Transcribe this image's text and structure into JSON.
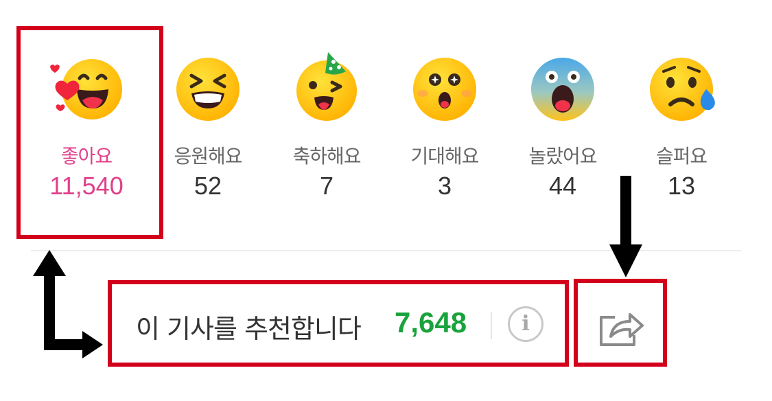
{
  "reactions": [
    {
      "name": "like",
      "label": "좋아요",
      "count": "11,540",
      "selected": true
    },
    {
      "name": "cheer",
      "label": "응원해요",
      "count": "52",
      "selected": false
    },
    {
      "name": "congrats",
      "label": "축하해요",
      "count": "7",
      "selected": false
    },
    {
      "name": "expect",
      "label": "기대해요",
      "count": "3",
      "selected": false
    },
    {
      "name": "surprised",
      "label": "놀랐어요",
      "count": "44",
      "selected": false
    },
    {
      "name": "sad",
      "label": "슬퍼요",
      "count": "13",
      "selected": false
    }
  ],
  "recommend": {
    "text": "이 기사를 추천합니다",
    "count": "7,648",
    "info_icon": "info-icon",
    "info_glyph": "i"
  },
  "share": {
    "icon": "share-icon"
  },
  "colors": {
    "selected": "#e0408a",
    "recommend_count": "#1aa33c",
    "annotation": "#d3001c",
    "face": "#ffc21a"
  }
}
